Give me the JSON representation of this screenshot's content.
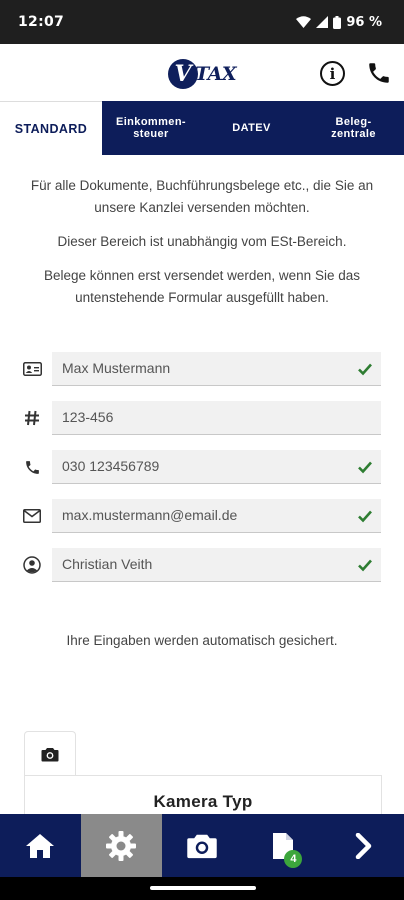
{
  "status_bar": {
    "time": "12:07",
    "battery": "96 %"
  },
  "header": {
    "logo_letter": "V",
    "logo_text": "TAX"
  },
  "tabs": [
    {
      "label": "STANDARD",
      "active": true
    },
    {
      "label_line1": "Einkommen-",
      "label_line2": "steuer",
      "active": false
    },
    {
      "label": "DATEV",
      "active": false
    },
    {
      "label_line1": "Beleg-",
      "label_line2": "zentrale",
      "active": false
    }
  ],
  "intro": {
    "p1": "Für alle Dokumente, Buchführungsbelege etc., die Sie an unsere Kanzlei versenden möchten.",
    "p2": "Dieser Bereich ist unabhängig vom ESt-Bereich.",
    "p3": "Belege können erst versendet werden, wenn Sie das untenstehende Formular ausgefüllt haben."
  },
  "form": {
    "name": {
      "value": "Max Mustermann",
      "icon": "id-card-icon",
      "valid": true
    },
    "number": {
      "value": "123-456",
      "icon": "hash-icon",
      "valid": false
    },
    "phone": {
      "value": "030 123456789",
      "icon": "phone-icon",
      "valid": true
    },
    "email": {
      "value": "max.mustermann@email.de",
      "icon": "mail-icon",
      "valid": true
    },
    "advisor": {
      "value": "Christian Veith",
      "icon": "user-circle-icon",
      "valid": true
    }
  },
  "autosave_note": "Ihre Eingaben werden automatisch gesichert.",
  "camera_card": {
    "title": "Kamera Typ",
    "tab_icon": "camera-icon"
  },
  "bottom_nav": {
    "items": [
      "home-icon",
      "settings-gear-icon",
      "camera-icon",
      "document-icon",
      "chevron-right-icon"
    ],
    "active": "settings-gear-icon",
    "document_badge": "4"
  },
  "colors": {
    "brand_navy": "#0d1d5a",
    "check_green": "#2e7d32",
    "badge_green": "#3ca63c"
  }
}
